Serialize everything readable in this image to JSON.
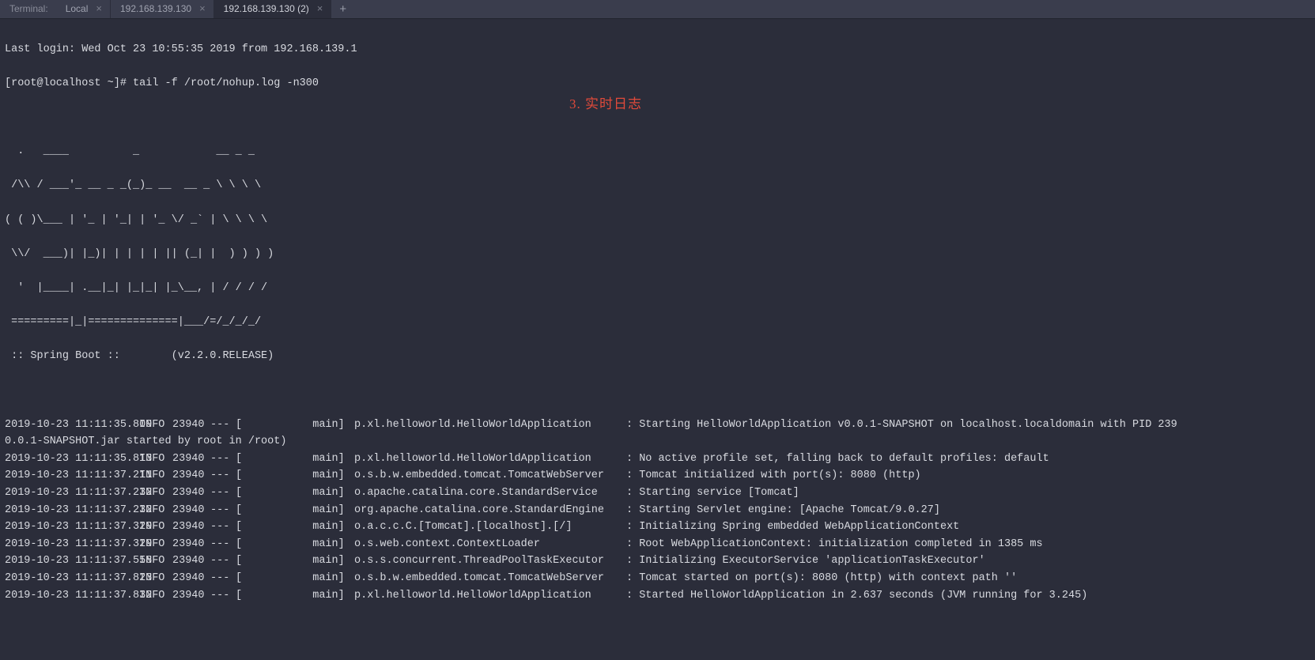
{
  "tab_bar": {
    "label": "Terminal:",
    "tabs": [
      {
        "title": "Local"
      },
      {
        "title": "192.168.139.130"
      },
      {
        "title": "192.168.139.130 (2)"
      }
    ],
    "add_symbol": "+"
  },
  "terminal": {
    "last_login": "Last login: Wed Oct 23 10:55:35 2019 from 192.168.139.1",
    "prompt": "[root@localhost ~]# ",
    "command": "tail -f /root/nohup.log -n300",
    "banner": [
      "  .   ____          _            __ _ _",
      " /\\\\ / ___'_ __ _ _(_)_ __  __ _ \\ \\ \\ \\",
      "( ( )\\___ | '_ | '_| | '_ \\/ _` | \\ \\ \\ \\",
      " \\\\/  ___)| |_)| | | | | || (_| |  ) ) ) )",
      "  '  |____| .__|_| |_|_| |_\\__, | / / / /",
      " =========|_|==============|___/=/_/_/_/"
    ],
    "boot_line": " :: Spring Boot ::        (v2.2.0.RELEASE)",
    "logs": [
      {
        "ts": "2019-10-23 11:11:35.809",
        "level": "INFO",
        "pid": "23940",
        "dash": "---",
        "thread": "[           main]",
        "logger": "p.xl.helloworld.HelloWorldApplication",
        "msg": ": Starting HelloWorldApplication v0.0.1-SNAPSHOT on localhost.localdomain with PID 239"
      },
      {
        "cont": "0.0.1-SNAPSHOT.jar started by root in /root)"
      },
      {
        "ts": "2019-10-23 11:11:35.813",
        "level": "INFO",
        "pid": "23940",
        "dash": "---",
        "thread": "[           main]",
        "logger": "p.xl.helloworld.HelloWorldApplication",
        "msg": ": No active profile set, falling back to default profiles: default"
      },
      {
        "ts": "2019-10-23 11:11:37.211",
        "level": "INFO",
        "pid": "23940",
        "dash": "---",
        "thread": "[           main]",
        "logger": "o.s.b.w.embedded.tomcat.TomcatWebServer",
        "msg": ": Tomcat initialized with port(s): 8080 (http)"
      },
      {
        "ts": "2019-10-23 11:11:37.232",
        "level": "INFO",
        "pid": "23940",
        "dash": "---",
        "thread": "[           main]",
        "logger": "o.apache.catalina.core.StandardService",
        "msg": ": Starting service [Tomcat]"
      },
      {
        "ts": "2019-10-23 11:11:37.232",
        "level": "INFO",
        "pid": "23940",
        "dash": "---",
        "thread": "[           main]",
        "logger": "org.apache.catalina.core.StandardEngine",
        "msg": ": Starting Servlet engine: [Apache Tomcat/9.0.27]"
      },
      {
        "ts": "2019-10-23 11:11:37.329",
        "level": "INFO",
        "pid": "23940",
        "dash": "---",
        "thread": "[           main]",
        "logger": "o.a.c.c.C.[Tomcat].[localhost].[/]",
        "msg": ": Initializing Spring embedded WebApplicationContext"
      },
      {
        "ts": "2019-10-23 11:11:37.329",
        "level": "INFO",
        "pid": "23940",
        "dash": "---",
        "thread": "[           main]",
        "logger": "o.s.web.context.ContextLoader",
        "msg": ": Root WebApplicationContext: initialization completed in 1385 ms"
      },
      {
        "ts": "2019-10-23 11:11:37.558",
        "level": "INFO",
        "pid": "23940",
        "dash": "---",
        "thread": "[           main]",
        "logger": "o.s.s.concurrent.ThreadPoolTaskExecutor",
        "msg": ": Initializing ExecutorService 'applicationTaskExecutor'"
      },
      {
        "ts": "2019-10-23 11:11:37.823",
        "level": "INFO",
        "pid": "23940",
        "dash": "---",
        "thread": "[           main]",
        "logger": "o.s.b.w.embedded.tomcat.TomcatWebServer",
        "msg": ": Tomcat started on port(s): 8080 (http) with context path ''"
      },
      {
        "ts": "2019-10-23 11:11:37.832",
        "level": "INFO",
        "pid": "23940",
        "dash": "---",
        "thread": "[           main]",
        "logger": "p.xl.helloworld.HelloWorldApplication",
        "msg": ": Started HelloWorldApplication in 2.637 seconds (JVM running for 3.245)"
      }
    ]
  },
  "annotation": "3. 实时日志",
  "icons": {
    "close_glyph": "×"
  }
}
